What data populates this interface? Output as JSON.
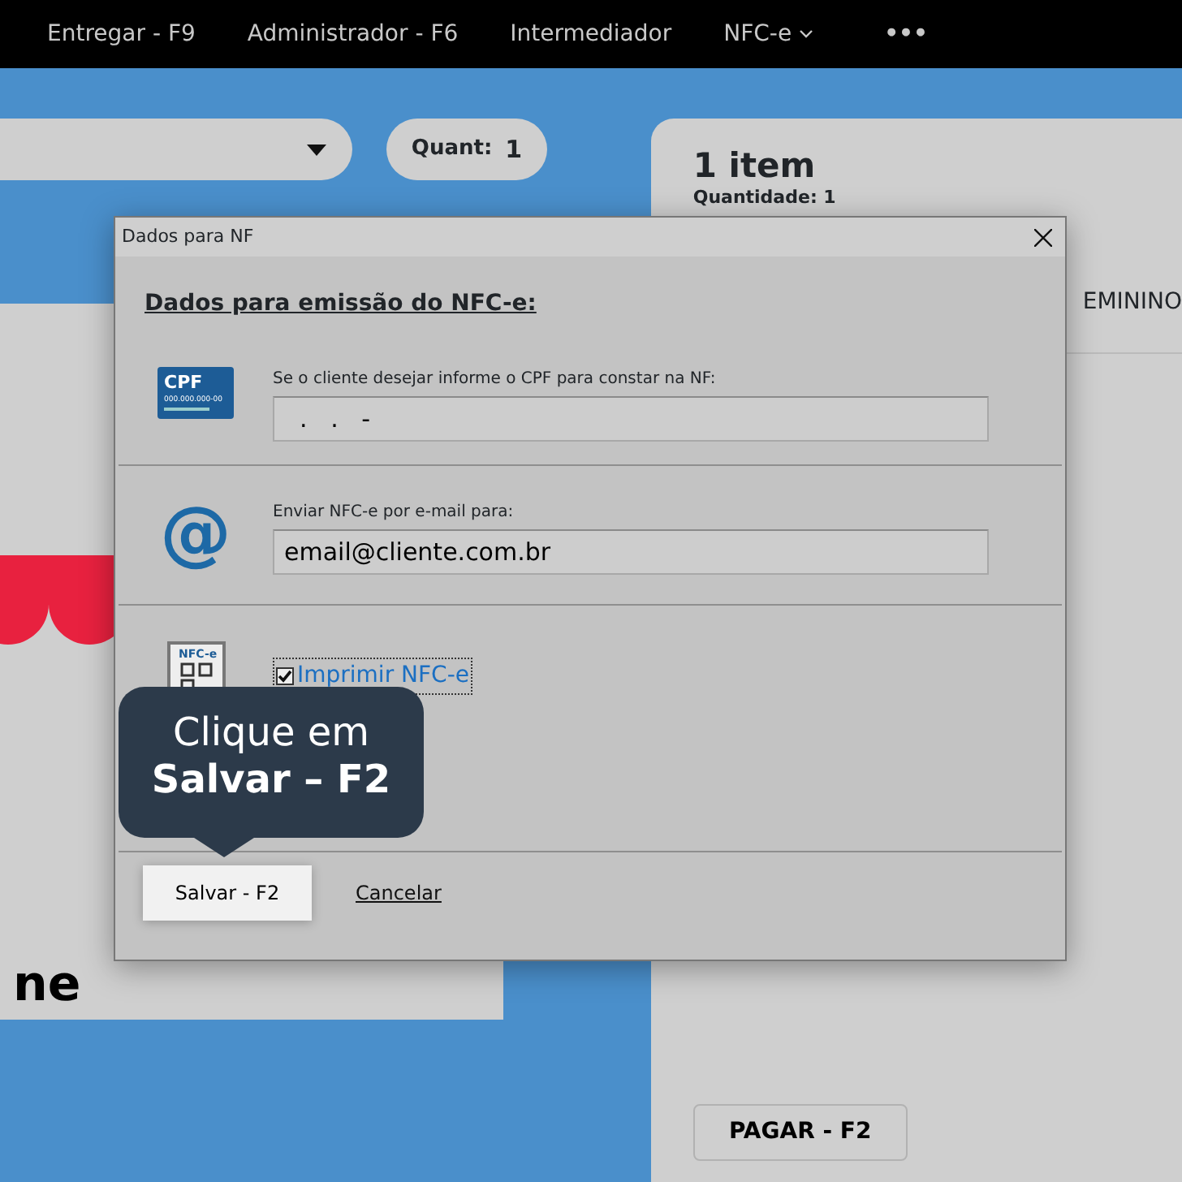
{
  "nav": {
    "items": [
      {
        "label": "Entregar - F9",
        "kind": "link"
      },
      {
        "label": "Administrador - F6",
        "kind": "link"
      },
      {
        "label": "Intermediador",
        "kind": "link"
      },
      {
        "label": "NFC-e",
        "kind": "dropdown"
      },
      {
        "label": "•••",
        "kind": "more"
      }
    ]
  },
  "quantity": {
    "label": "Quant:",
    "value": "1"
  },
  "logo": {
    "text": "ne"
  },
  "order_panel": {
    "title": "1 item",
    "subtitle": "Quantidade: 1",
    "item_name": "EMININO",
    "pay_button": "PAGAR - F2"
  },
  "dialog": {
    "title": "Dados para NF",
    "heading": "Dados para emissão do NFC-e:",
    "cpf": {
      "icon_title": "CPF",
      "icon_number": "000.000.000-00",
      "label": "Se o cliente desejar informe o CPF para constar na NF:",
      "value": "  .   .   -"
    },
    "email": {
      "icon": "@",
      "label": "Enviar NFC-e por e-mail para:",
      "value": "email@cliente.com.br"
    },
    "print": {
      "icon_label": "NFC-e",
      "label": "Imprimir NFC-e",
      "checked": true
    },
    "save_button": "Salvar - F2",
    "cancel_link": "Cancelar"
  },
  "tooltip": {
    "line_1": "Clique em",
    "line_2": "Salvar – F2"
  }
}
